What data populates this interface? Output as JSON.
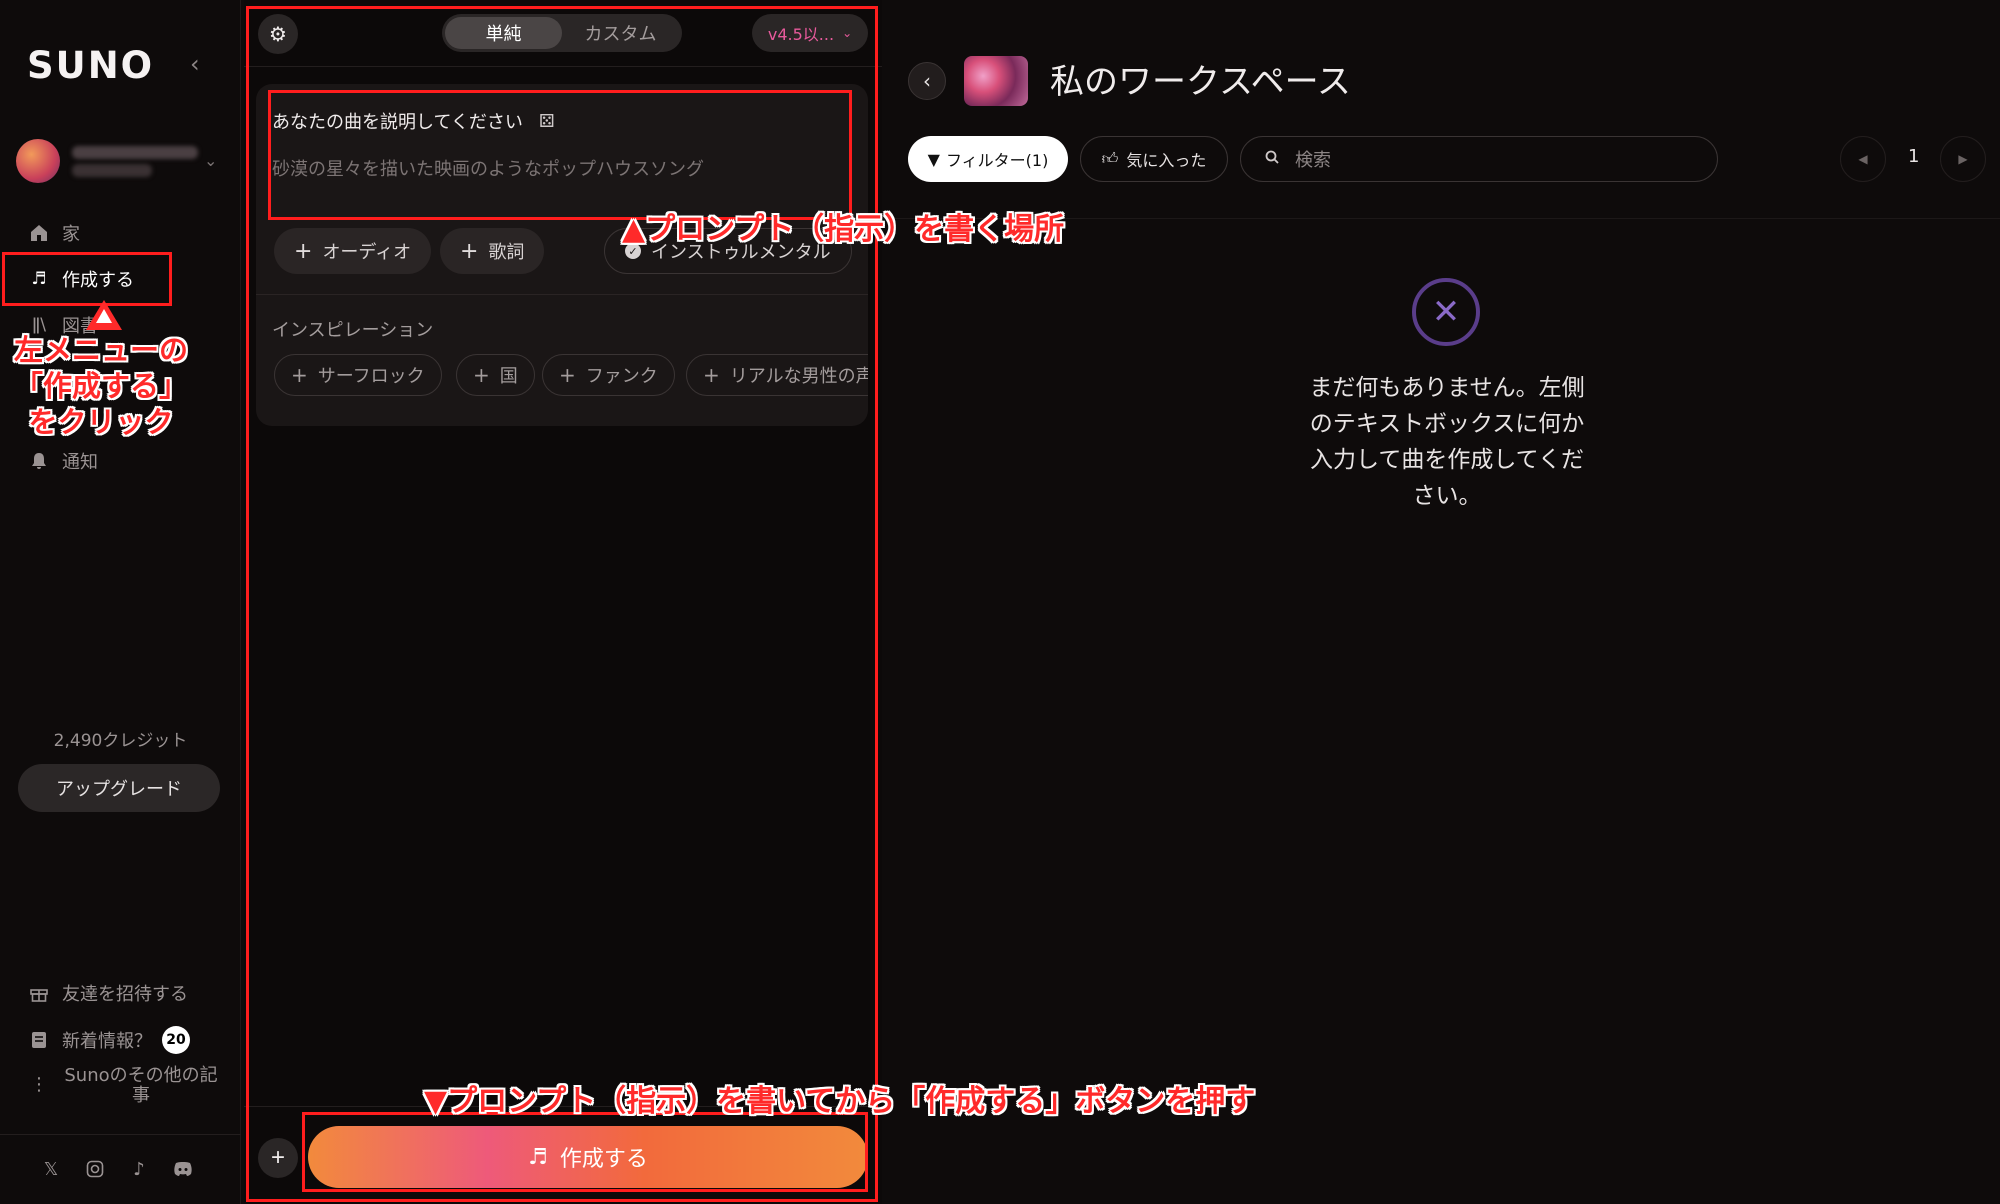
{
  "sidebar": {
    "logo": "SUNO",
    "nav": [
      {
        "label": "家",
        "icon": "home-icon"
      },
      {
        "label": "作成する",
        "icon": "music-create-icon"
      },
      {
        "label": "図書",
        "icon": "library-icon"
      },
      {
        "label": "通知",
        "icon": "bell-icon"
      }
    ],
    "credits": "2,490クレジット",
    "upgrade": "アップグレード",
    "footer": [
      {
        "label": "友達を招待する",
        "icon": "gift-icon"
      },
      {
        "label": "新着情報？",
        "icon": "news-icon",
        "badge": "20"
      },
      {
        "label": "Sunoのその他の記事",
        "icon": "more-dots-icon"
      }
    ]
  },
  "middle": {
    "mode_tabs": [
      "単純",
      "カスタム"
    ],
    "active_mode": "単純",
    "version": "v4.5以...",
    "prompt_label": "あなたの曲を説明してください",
    "prompt_placeholder": "砂漠の星々を描いた映画のようなポップハウスソング",
    "chips": {
      "audio": "オーディオ",
      "lyrics": "歌詞",
      "instrumental": "インストゥルメンタル"
    },
    "inspiration_label": "インスピレーション",
    "inspiration": [
      "サーフロック",
      "国",
      "ファンク",
      "リアルな男性の声"
    ],
    "create_button": "作成する"
  },
  "right": {
    "title": "私のワークスペース",
    "filter": "フィルター(1)",
    "liked": "気に入った",
    "search_placeholder": "検索",
    "page": "1",
    "empty_message": "まだ何もありません。左側のテキストボックスに何か入力して曲を作成してください。"
  },
  "annotations": {
    "left_menu": "左メニューの\n「作成する」\nをクリック",
    "prompt_area": "▲プロンプト（指示）を書く場所",
    "create_hint": "▼プロンプト（指示）を書いてから「作成する」ボタンを押す"
  },
  "colors": {
    "accent": "#e85a9c",
    "annotation": "#ff1d1d",
    "create_gradient_start": "#f28a3c",
    "create_gradient_mid": "#ee5a7a"
  }
}
